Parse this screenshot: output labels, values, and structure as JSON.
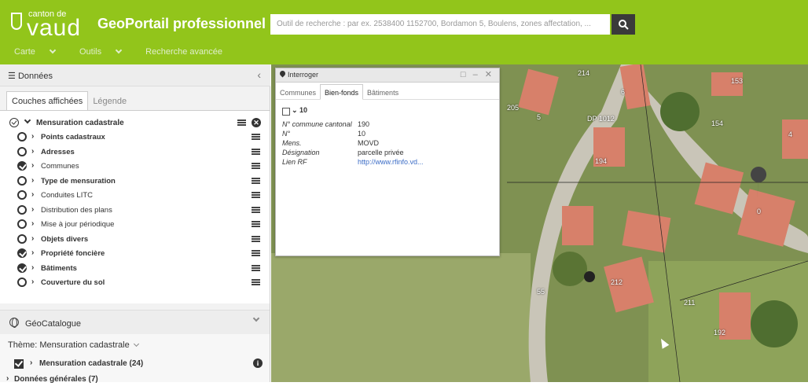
{
  "header": {
    "logo_small": "canton de",
    "logo_big": "vaud",
    "app_title": "GeoPortail professionnel",
    "search_placeholder": "Outil de recherche : par ex. 2538400 1152700, Bordamon 5, Boulens, zones affectation, ...",
    "search_icon": "search-icon",
    "menu": [
      "Carte",
      "Outils",
      "Recherche avancée"
    ]
  },
  "left_panel": {
    "title": "Données",
    "tabs": [
      "Couches affichées",
      "Légende"
    ],
    "group": {
      "label": "Mensuration cadastrale",
      "checked": true
    },
    "layers": [
      {
        "label": "Points cadastraux",
        "bold": true,
        "checked": false
      },
      {
        "label": "Adresses",
        "bold": true,
        "checked": false
      },
      {
        "label": "Communes",
        "bold": false,
        "checked": true
      },
      {
        "label": "Type de mensuration",
        "bold": true,
        "checked": false
      },
      {
        "label": "Conduites LITC",
        "bold": false,
        "checked": false
      },
      {
        "label": "Distribution des plans",
        "bold": false,
        "checked": false
      },
      {
        "label": "Mise à jour périodique",
        "bold": false,
        "checked": false
      },
      {
        "label": "Objets divers",
        "bold": true,
        "checked": false
      },
      {
        "label": "Propriété foncière",
        "bold": true,
        "checked": true
      },
      {
        "label": "Bâtiments",
        "bold": true,
        "checked": true
      },
      {
        "label": "Couverture du sol",
        "bold": true,
        "checked": false
      }
    ]
  },
  "geocatalogue": {
    "title": "GéoCatalogue",
    "theme_label": "Thème: Mensuration cadastrale",
    "items": [
      {
        "label": "Mensuration cadastrale (24)",
        "checked": true
      },
      {
        "label": "Données générales (7)",
        "checked": false
      }
    ]
  },
  "popup": {
    "title": "Interroger",
    "controls": "□ – ✕",
    "tabs": [
      "Communes",
      "Bien-fonds",
      "Bâtiments"
    ],
    "active_tab": "Bien-fonds",
    "parcel_number": "10",
    "fields": [
      {
        "key": "N° commune cantonal",
        "value": "190",
        "link": false
      },
      {
        "key": "N°",
        "value": "10",
        "link": false
      },
      {
        "key": "Mens.",
        "value": "MOVD",
        "link": false
      },
      {
        "key": "Désignation",
        "value": "parcelle privée",
        "link": false
      },
      {
        "key": "Lien RF",
        "value": "http://www.rfinfo.vd...",
        "link": true
      }
    ]
  },
  "map": {
    "labels": [
      "214",
      "153",
      "205",
      "DP 1012",
      "154",
      "194",
      "212",
      "55",
      "211",
      "192"
    ],
    "label_codes": [
      "6",
      "4",
      "5",
      "0"
    ]
  },
  "colors": {
    "accent": "#92c51b",
    "search_button": "#3a3a3a",
    "link": "#3b6cc6"
  }
}
